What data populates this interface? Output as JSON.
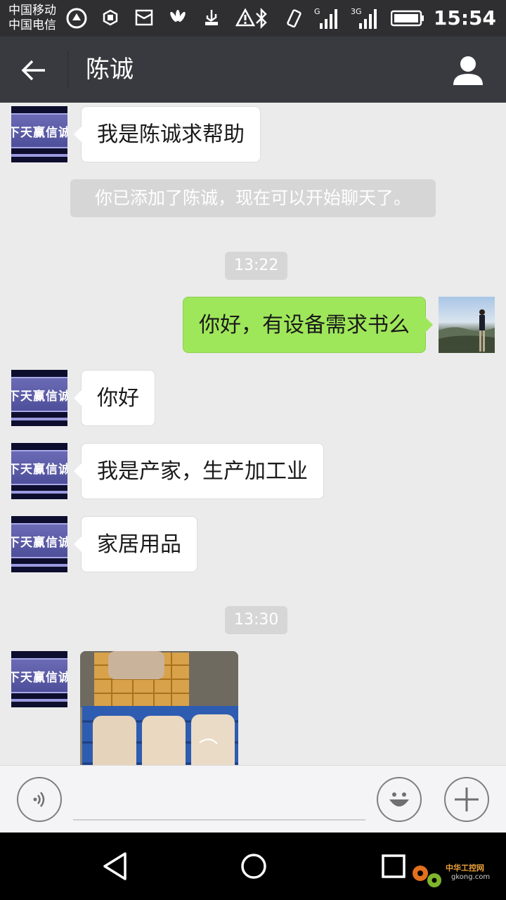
{
  "status_bar": {
    "carrier_1": "中国移动",
    "carrier_2": "中国电信",
    "network_1": "G",
    "network_2": "3G",
    "time": "15:54",
    "icons": [
      "alarm-icon",
      "hand-icon",
      "mail-icon",
      "huawei-icon",
      "usb-icon",
      "warning-icon",
      "bluetooth-icon",
      "vibrate-icon",
      "signal-icon",
      "battery-icon"
    ]
  },
  "app_bar": {
    "title": "陈诚",
    "back_icon": "back-arrow-icon",
    "profile_icon": "person-icon"
  },
  "chat": {
    "contact_avatar_text": "下天赢信诚",
    "messages": [
      {
        "type": "incoming",
        "text": "我是陈诚求帮助"
      },
      {
        "type": "system",
        "text": "你已添加了陈诚，现在可以开始聊天了。"
      },
      {
        "type": "timestamp",
        "text": "13:22"
      },
      {
        "type": "outgoing",
        "text": "你好，有设备需求书么"
      },
      {
        "type": "incoming",
        "text": "你好"
      },
      {
        "type": "incoming",
        "text": "我是产家，生产加工业"
      },
      {
        "type": "incoming",
        "text": "家居用品"
      },
      {
        "type": "timestamp",
        "text": "13:30"
      },
      {
        "type": "incoming-image",
        "text": ""
      }
    ]
  },
  "input_bar": {
    "voice_icon": "voice-icon",
    "emoji_icon": "emoji-icon",
    "plus_icon": "plus-icon",
    "input_value": ""
  },
  "nav_bar": {
    "back_icon": "nav-back-icon",
    "home_icon": "nav-home-icon",
    "recents_icon": "nav-recents-icon"
  },
  "watermark": {
    "text": "中华工控网",
    "url": "gkong.com"
  },
  "colors": {
    "status_bar": "#2f2f31",
    "app_bar": "#393a3f",
    "chat_bg": "#ebebeb",
    "outgoing_bubble": "#9fe75a",
    "incoming_bubble": "#ffffff"
  }
}
